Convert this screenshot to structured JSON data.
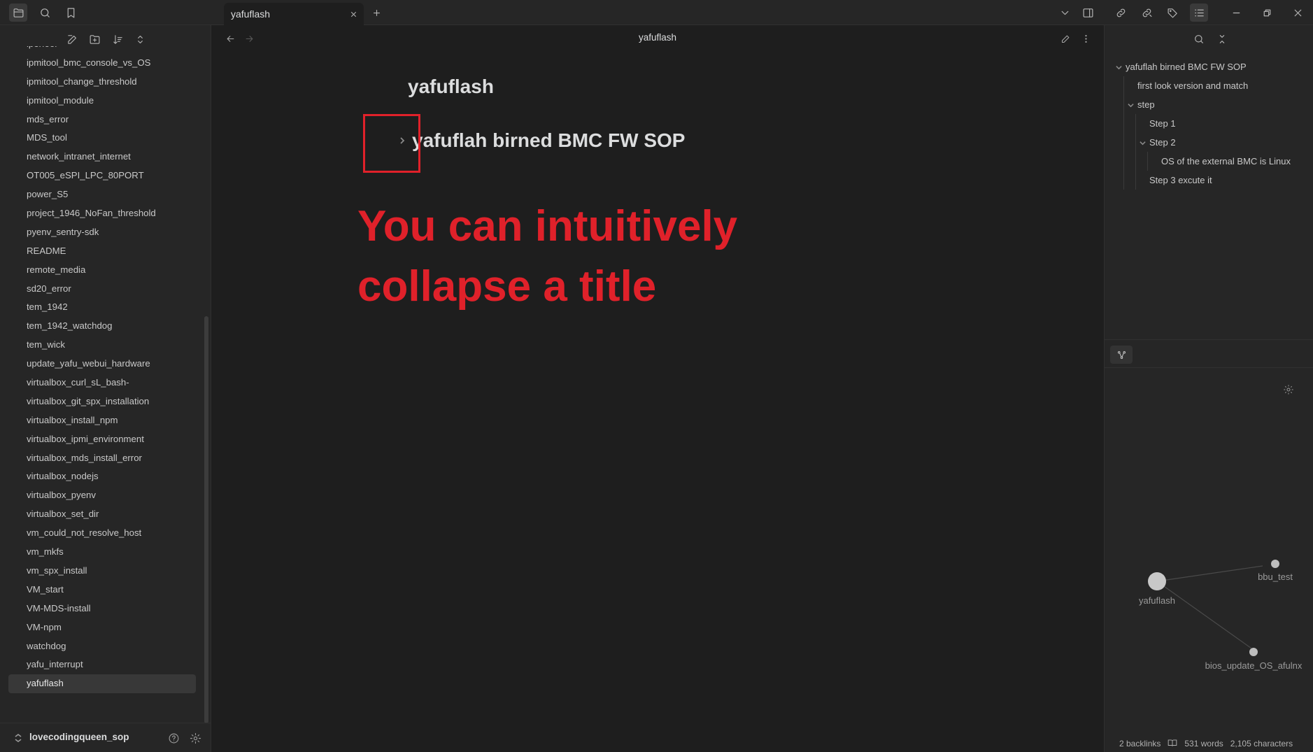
{
  "tab": {
    "title": "yafuflash"
  },
  "left_sidebar": {
    "files": [
      "iperfool",
      "ipmitool_bmc_console_vs_OS",
      "ipmitool_change_threshold",
      "ipmitool_module",
      "mds_error",
      "MDS_tool",
      "network_intranet_internet",
      "OT005_eSPI_LPC_80PORT",
      "power_S5",
      "project_1946_NoFan_threshold",
      "pyenv_sentry-sdk",
      "README",
      "remote_media",
      "sd20_error",
      "tem_1942",
      "tem_1942_watchdog",
      "tem_wick",
      "update_yafu_webui_hardware",
      "virtualbox_curl_sL_bash-",
      "virtualbox_git_spx_installation",
      "virtualbox_install_npm",
      "virtualbox_ipmi_environment",
      "virtualbox_mds_install_error",
      "virtualbox_nodejs",
      "virtualbox_pyenv",
      "virtualbox_set_dir",
      "vm_could_not_resolve_host",
      "vm_mkfs",
      "vm_spx_install",
      "VM_start",
      "VM-MDS-install",
      "VM-npm",
      "watchdog",
      "yafu_interrupt",
      "yafuflash"
    ],
    "active_file": "yafuflash",
    "vault_name": "lovecodingqueen_sop"
  },
  "editor": {
    "view_title": "yafuflash",
    "doc_title": "yafuflash",
    "heading": "yafuflah birned BMC FW SOP",
    "annotation_line1": "You can intuitively",
    "annotation_line2": "collapse a title",
    "annotation_color": "#e0212a"
  },
  "outline": {
    "items": [
      {
        "label": "yafuflah birned BMC FW SOP",
        "level": 0,
        "collapsible": true
      },
      {
        "label": "first look version and match",
        "level": 1,
        "collapsible": false
      },
      {
        "label": "step",
        "level": 1,
        "collapsible": true
      },
      {
        "label": "Step 1",
        "level": 2,
        "collapsible": false
      },
      {
        "label": "Step 2",
        "level": 2,
        "collapsible": true
      },
      {
        "label": "OS of the external BMC is Linux",
        "level": 3,
        "collapsible": false
      },
      {
        "label": "Step 3 excute it",
        "level": 2,
        "collapsible": false
      }
    ]
  },
  "graph": {
    "nodes": [
      {
        "label": "yafuflash"
      },
      {
        "label": "bbu_test"
      },
      {
        "label": "bios_update_OS_afulnx"
      }
    ]
  },
  "statusbar": {
    "backlinks": "2 backlinks",
    "words": "531 words",
    "characters": "2,105 characters"
  }
}
